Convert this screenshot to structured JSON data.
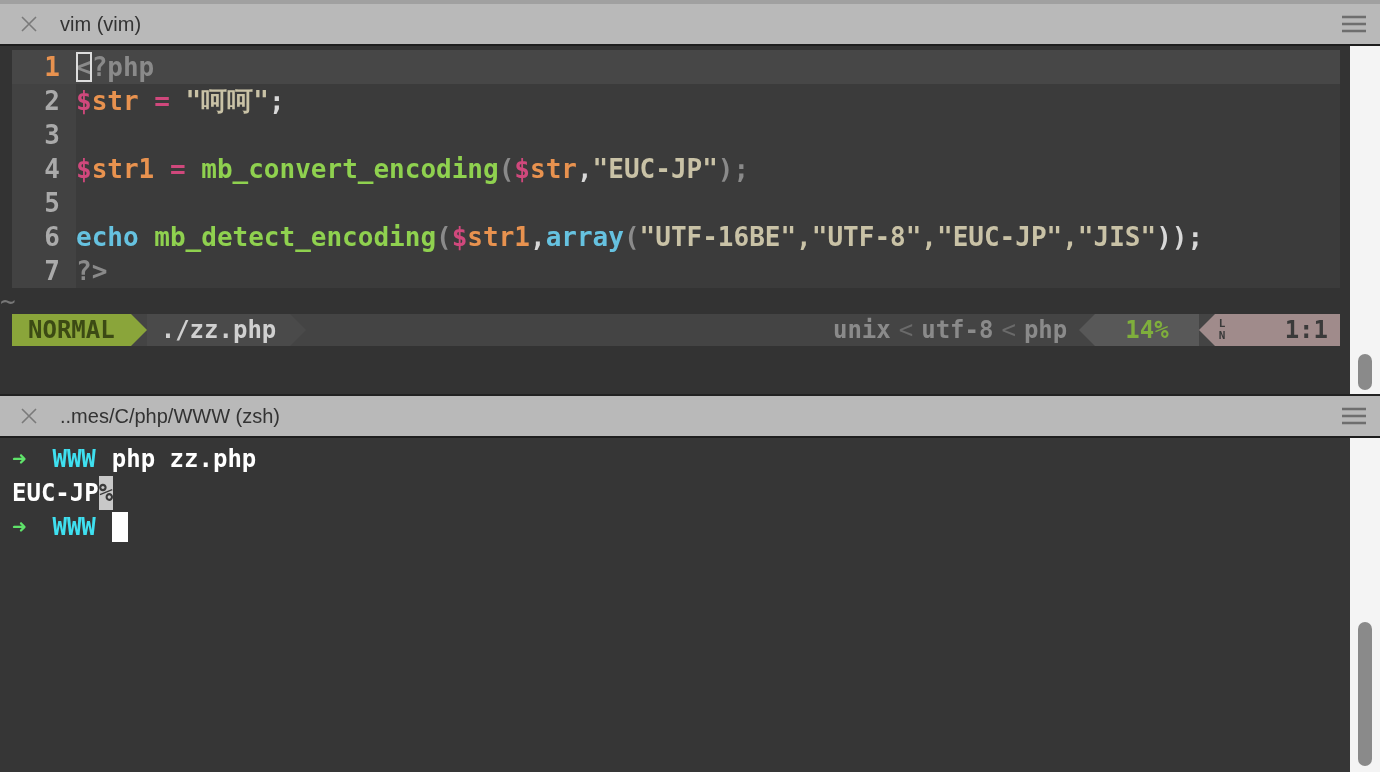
{
  "panes": [
    {
      "kind": "editor",
      "title": "vim (vim)",
      "lines": [
        {
          "number": "1",
          "selected": true,
          "tokens": [
            {
              "text": "<",
              "kind": "tag",
              "cursor": true
            },
            {
              "text": "?php",
              "kind": "tag"
            }
          ]
        },
        {
          "number": "2",
          "selected": false,
          "tokens": [
            {
              "text": "$",
              "kind": "sigil"
            },
            {
              "text": "str",
              "kind": "var"
            },
            {
              "text": " = ",
              "kind": "op"
            },
            {
              "text": "\"呵呵\"",
              "kind": "str"
            },
            {
              "text": ";",
              "kind": "punct"
            }
          ]
        },
        {
          "number": "3",
          "selected": false
        },
        {
          "number": "4",
          "selected": false,
          "tokens": [
            {
              "text": "$",
              "kind": "sigil"
            },
            {
              "text": "str1",
              "kind": "var"
            },
            {
              "text": " = ",
              "kind": "op"
            },
            {
              "text": "mb_convert_encoding",
              "kind": "func"
            },
            {
              "text": "(",
              "kind": "paren"
            },
            {
              "text": "$",
              "kind": "sigil"
            },
            {
              "text": "str",
              "kind": "var"
            },
            {
              "text": ",",
              "kind": "punct"
            },
            {
              "text": "\"EUC-JP\"",
              "kind": "str"
            },
            {
              "text": ");",
              "kind": "paren"
            }
          ]
        },
        {
          "number": "5",
          "selected": false
        },
        {
          "number": "6",
          "selected": false,
          "tokens": [
            {
              "text": "echo",
              "kind": "kw"
            },
            {
              "text": " mb_detect_encoding",
              "kind": "func"
            },
            {
              "text": "(",
              "kind": "paren"
            },
            {
              "text": "$",
              "kind": "sigil"
            },
            {
              "text": "str1",
              "kind": "var"
            },
            {
              "text": ",",
              "kind": "punct"
            },
            {
              "text": "array",
              "kind": "kw"
            },
            {
              "text": "(",
              "kind": "paren"
            },
            {
              "text": "\"UTF-16BE\",\"UTF-8\",\"EUC-JP\",\"JIS\"",
              "kind": "str"
            },
            {
              "text": "));",
              "kind": "punct"
            }
          ]
        },
        {
          "number": "7",
          "selected": false,
          "tokens": [
            {
              "text": "?>",
              "kind": "tag"
            }
          ]
        }
      ],
      "tilde": "~",
      "status": {
        "mode": "NORMAL",
        "file": "./zz.php",
        "format": "unix",
        "sep1": "<",
        "encoding": "utf-8",
        "sep2": "<",
        "filetype": "php",
        "percent": "14%",
        "ln": "LN",
        "position": "1:1"
      }
    },
    {
      "kind": "shell",
      "title": "..mes/C/php/WWW (zsh)",
      "lines": [
        {
          "cursor": false,
          "tokens": [
            {
              "text": "➜",
              "kind": "arrow"
            },
            {
              "text": "WWW",
              "kind": "dir"
            },
            {
              "text": "php zz.php",
              "kind": "cmd"
            }
          ]
        },
        {
          "cursor": false,
          "tokens": [
            {
              "text": "EUC-JP",
              "kind": "out"
            },
            {
              "text": "%",
              "kind": "eol"
            }
          ]
        },
        {
          "cursor": true,
          "tokens": [
            {
              "text": "➜",
              "kind": "arrow"
            },
            {
              "text": "WWW",
              "kind": "dir"
            }
          ]
        }
      ]
    }
  ]
}
